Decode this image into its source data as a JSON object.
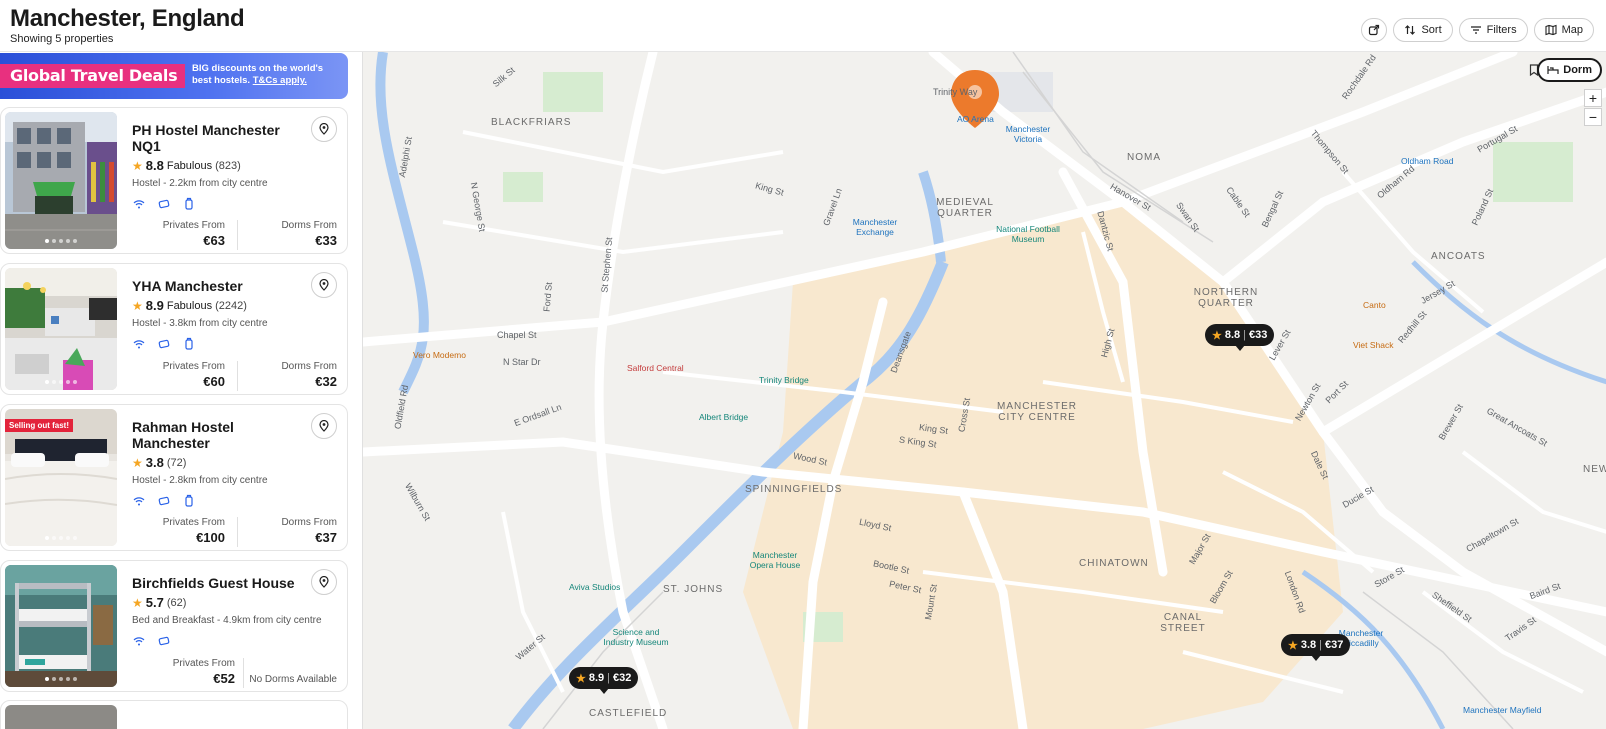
{
  "header": {
    "title": "Manchester, England",
    "subtitle": "Showing 5 properties",
    "toolbar": {
      "share_icon": "share-icon",
      "sort_label": "Sort",
      "filters_label": "Filters",
      "map_label": "Map"
    }
  },
  "banner": {
    "tag": "Global Travel Deals",
    "text": "BIG discounts on the world's best hostels.",
    "link": "T&Cs apply."
  },
  "properties": [
    {
      "name": "PH Hostel Manchester NQ1",
      "score": "8.8",
      "rating_word": "Fabulous",
      "reviews": "(823)",
      "desc": "Hostel - 2.2km from city centre",
      "badge": "",
      "privates_label": "Privates From",
      "privates_price": "€63",
      "dorms_label": "Dorms From",
      "dorms_price": "€33"
    },
    {
      "name": "YHA Manchester",
      "score": "8.9",
      "rating_word": "Fabulous",
      "reviews": "(2242)",
      "desc": "Hostel - 3.8km from city centre",
      "badge": "",
      "privates_label": "Privates From",
      "privates_price": "€60",
      "dorms_label": "Dorms From",
      "dorms_price": "€32"
    },
    {
      "name": "Rahman Hostel Manchester",
      "score": "3.8",
      "rating_word": "",
      "reviews": "(72)",
      "desc": "Hostel - 2.8km from city centre",
      "badge": "Selling out fast!",
      "privates_label": "Privates From",
      "privates_price": "€100",
      "dorms_label": "Dorms From",
      "dorms_price": "€37"
    },
    {
      "name": "Birchfields Guest House",
      "score": "5.7",
      "rating_word": "",
      "reviews": "(62)",
      "desc": "Bed and Breakfast - 4.9km from city centre",
      "badge": "",
      "privates_label": "Privates From",
      "privates_price": "€52",
      "no_dorms": "No Dorms Available"
    }
  ],
  "map": {
    "dorm_toggle": "Dorm",
    "zoom_in": "+",
    "zoom_out": "−",
    "pins": [
      {
        "score": "8.8",
        "price": "€33"
      },
      {
        "score": "3.8",
        "price": "€37"
      },
      {
        "score": "8.9",
        "price": "€32"
      }
    ],
    "areas": [
      "BLACKFRIARS",
      "NOMA",
      "MEDIEVAL QUARTER",
      "NORTHERN QUARTER",
      "ANCOATS",
      "MANCHESTER CITY CENTRE",
      "SPINNINGFIELDS",
      "CHINATOWN",
      "ST. JOHNS",
      "CANAL STREET",
      "CASTLEFIELD",
      "NEW ISLIN"
    ],
    "pois": [
      "AO Arena",
      "Manchester Victoria",
      "Manchester Exchange",
      "National Football Museum",
      "Oldham Road",
      "Canto",
      "Viet Shack",
      "Vero Modemo",
      "Salford Central",
      "Trinity Bridge",
      "Albert Bridge",
      "Manchester Opera House",
      "Aviva Studios",
      "Science and Industry Museum",
      "Manchester Piccadilly",
      "Manchester Mayfield"
    ],
    "streets": [
      "Silk St",
      "Trinity Way",
      "King St",
      "Thompson St",
      "Oldham Rd",
      "Hanover St",
      "Swan St",
      "Cable St",
      "Bengal St",
      "Redhill St",
      "Poland St",
      "Portugal St",
      "Rochdale Rd",
      "Adelphi St",
      "N George St",
      "Gravel Ln",
      "St Stephen St",
      "Ford St",
      "Chapel St",
      "N Star Dr",
      "Oldfield Rd",
      "E Ordsall Ln",
      "Deansgate",
      "High St",
      "Dantzic St",
      "Lever St",
      "Jersey St",
      "Newton St",
      "Port St",
      "Dale St",
      "Great Ancoats St",
      "Ducie St",
      "Store St",
      "Chapeltown St",
      "Wood St",
      "King St",
      "S King St",
      "Cross St",
      "Lloyd St",
      "Bootle St",
      "Peter St",
      "Mount St",
      "Major St",
      "Bloom St",
      "London Rd",
      "Sheffield St",
      "Travis St",
      "Baird St",
      "Water St",
      "Wilburn St",
      "Brewer St"
    ]
  }
}
